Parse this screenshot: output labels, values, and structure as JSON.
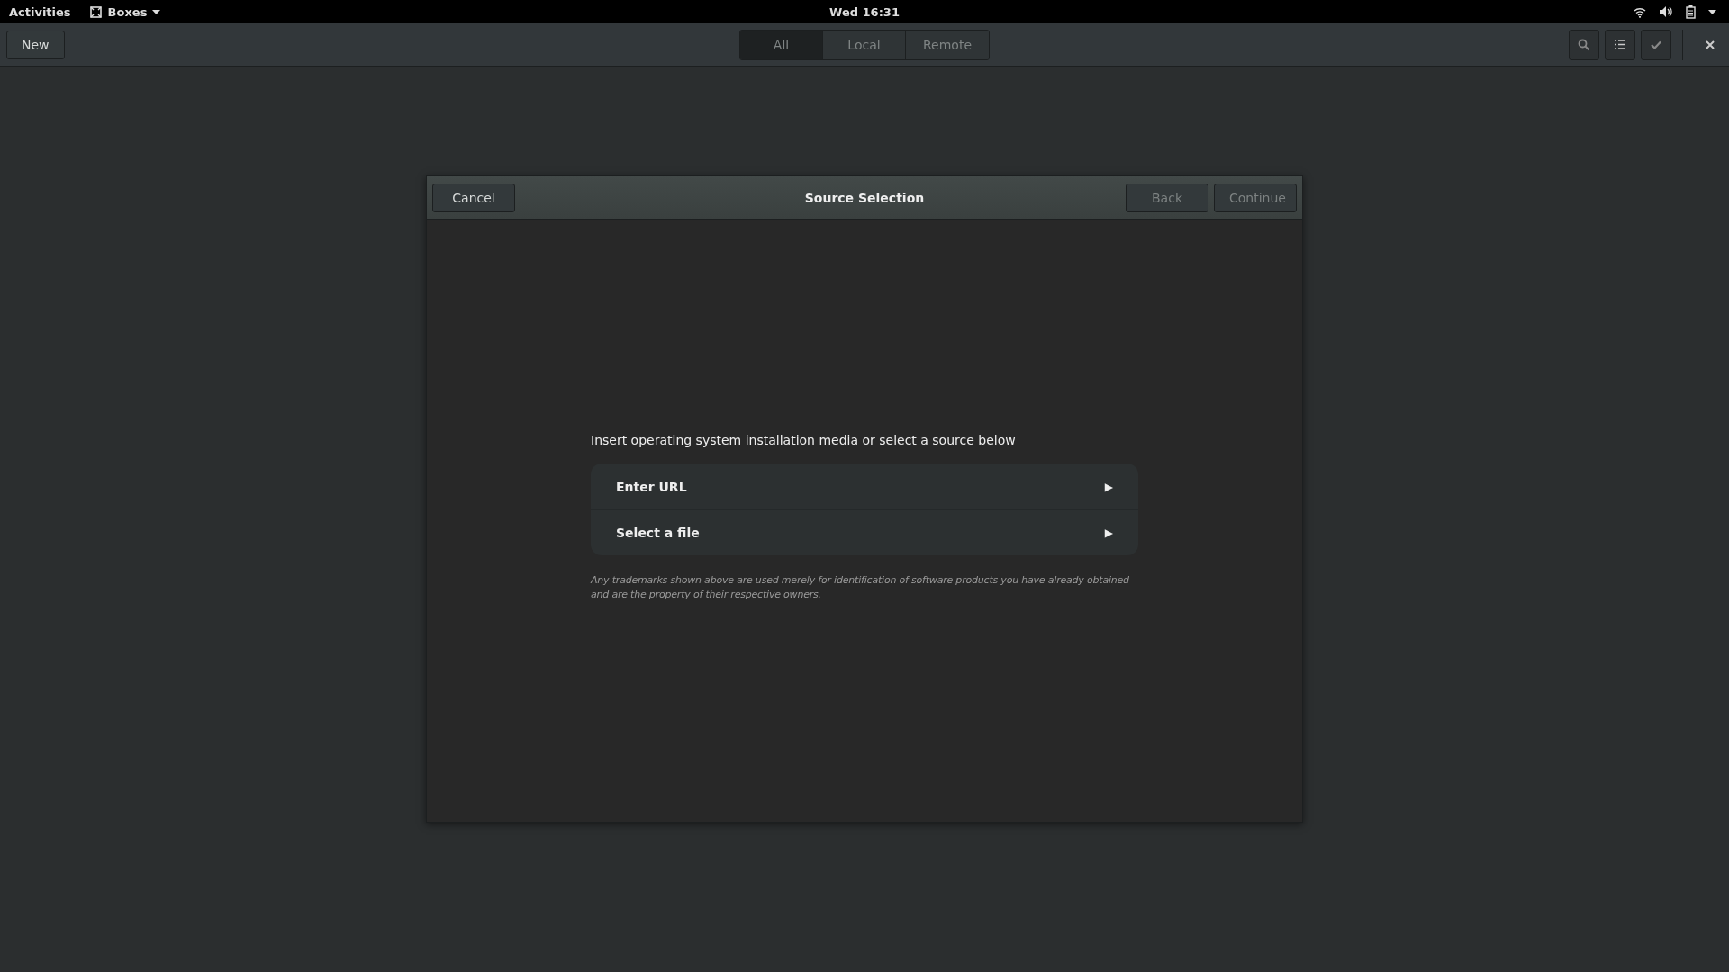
{
  "top_bar": {
    "activities": "Activities",
    "app_menu": "Boxes",
    "clock": "Wed 16:31"
  },
  "toolbar": {
    "new_button": "New",
    "tabs": [
      {
        "label": "All",
        "selected": true
      },
      {
        "label": "Local",
        "selected": false
      },
      {
        "label": "Remote",
        "selected": false
      }
    ]
  },
  "dialog": {
    "title": "Source Selection",
    "cancel": "Cancel",
    "back": {
      "label": "Back",
      "disabled": true
    },
    "continue": {
      "label": "Continue",
      "disabled": true
    },
    "prompt": "Insert operating system installation media or select a source below",
    "sources": [
      {
        "label": "Enter URL",
        "arrow": "▶"
      },
      {
        "label": "Select a file",
        "arrow": "▶"
      }
    ],
    "disclaimer": "Any trademarks shown above are used merely for identification of software products you have already obtained and are the property of their respective owners."
  }
}
